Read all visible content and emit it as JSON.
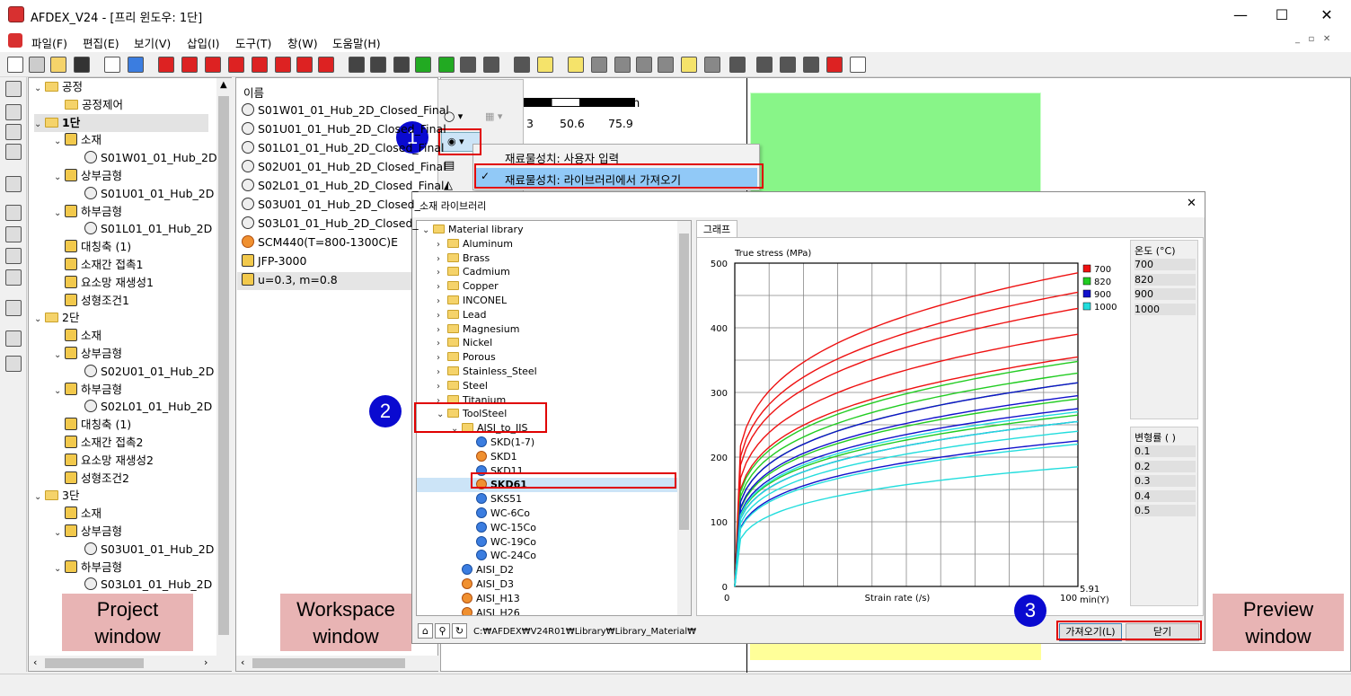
{
  "window": {
    "title": "AFDEX_V24 - [프리 윈도우: 1단]",
    "min": "—",
    "max": "☐",
    "close": "✕"
  },
  "menu": [
    "파일(F)",
    "편집(E)",
    "보기(V)",
    "삽입(I)",
    "도구(T)",
    "창(W)",
    "도움말(H)"
  ],
  "project_tree": [
    {
      "label": "공정",
      "icon": "folder-icon"
    },
    {
      "label": "공정제어",
      "icon": "folder-icon"
    },
    {
      "label": "1단",
      "icon": "folder-icon"
    },
    {
      "label": "소재",
      "icon": "material-icon"
    },
    {
      "label": "S01W01_01_Hub_2D",
      "icon": "mesh-icon"
    },
    {
      "label": "상부금형",
      "icon": "upper-die-icon"
    },
    {
      "label": "S01U01_01_Hub_2D",
      "icon": "mesh-icon"
    },
    {
      "label": "하부금형",
      "icon": "lower-die-icon"
    },
    {
      "label": "S01L01_01_Hub_2D",
      "icon": "mesh-icon"
    },
    {
      "label": "대칭축 (1)",
      "icon": "symmetry-icon"
    },
    {
      "label": "소재간 접촉1",
      "icon": "contact-icon"
    },
    {
      "label": "요소망 재생성1",
      "icon": "remesh-icon"
    },
    {
      "label": "성형조건1",
      "icon": "condition-icon"
    },
    {
      "label": "2단",
      "icon": "folder-icon"
    },
    {
      "label": "소재",
      "icon": "material-icon"
    },
    {
      "label": "상부금형",
      "icon": "upper-die-icon"
    },
    {
      "label": "S02U01_01_Hub_2D",
      "icon": "mesh-icon"
    },
    {
      "label": "하부금형",
      "icon": "lower-die-icon"
    },
    {
      "label": "S02L01_01_Hub_2D",
      "icon": "mesh-icon"
    },
    {
      "label": "대칭축 (1)",
      "icon": "symmetry-icon"
    },
    {
      "label": "소재간 접촉2",
      "icon": "contact-icon"
    },
    {
      "label": "요소망 재생성2",
      "icon": "remesh-icon"
    },
    {
      "label": "성형조건2",
      "icon": "condition-icon"
    },
    {
      "label": "3단",
      "icon": "folder-icon"
    },
    {
      "label": "소재",
      "icon": "material-icon"
    },
    {
      "label": "상부금형",
      "icon": "upper-die-icon"
    },
    {
      "label": "S03U01_01_Hub_2D",
      "icon": "mesh-icon"
    },
    {
      "label": "하부금형",
      "icon": "lower-die-icon"
    },
    {
      "label": "S03L01_01_Hub_2D",
      "icon": "mesh-icon"
    }
  ],
  "workspace": {
    "header": "이름",
    "items": [
      "S01W01_01_Hub_2D_Closed_Final",
      "S01U01_01_Hub_2D_Closed_Final",
      "S01L01_01_Hub_2D_Closed_Final",
      "S02U01_01_Hub_2D_Closed_Final",
      "S02L01_01_Hub_2D_Closed_Final",
      "S03U01_01_Hub_2D_Closed_",
      "S03L01_01_Hub_2D_Closed_",
      "SCM440(T=800-1300C)E",
      "JFP-3000",
      "u=0.3, m=0.8"
    ]
  },
  "scale": {
    "unit": "mm",
    "ticks": [
      "3",
      "50.6",
      "75.9"
    ]
  },
  "dropdown_menu": {
    "item1": "재료물성치: 사용자 입력",
    "item2": "재료물성치: 라이브러리에서 가져오기",
    "check": "✓"
  },
  "dialog": {
    "title": "소재 라이브러리",
    "close": "✕",
    "tab": "그래프",
    "path": "C:₩AFDEX₩V24R01₩Library₩Library_Material₩",
    "import_button": "가져오기(L)",
    "close_button": "닫기",
    "tree": [
      {
        "label": "Material library",
        "indent": 0,
        "type": "folder",
        "chev": "⌄"
      },
      {
        "label": "Aluminum",
        "indent": 1,
        "type": "folder",
        "chev": "›"
      },
      {
        "label": "Brass",
        "indent": 1,
        "type": "folder",
        "chev": "›"
      },
      {
        "label": "Cadmium",
        "indent": 1,
        "type": "folder",
        "chev": "›"
      },
      {
        "label": "Copper",
        "indent": 1,
        "type": "folder",
        "chev": "›"
      },
      {
        "label": "INCONEL",
        "indent": 1,
        "type": "folder",
        "chev": "›"
      },
      {
        "label": "Lead",
        "indent": 1,
        "type": "folder",
        "chev": "›"
      },
      {
        "label": "Magnesium",
        "indent": 1,
        "type": "folder",
        "chev": "›"
      },
      {
        "label": "Nickel",
        "indent": 1,
        "type": "folder",
        "chev": "›"
      },
      {
        "label": "Porous",
        "indent": 1,
        "type": "folder",
        "chev": "›"
      },
      {
        "label": "Stainless_Steel",
        "indent": 1,
        "type": "folder",
        "chev": "›"
      },
      {
        "label": "Steel",
        "indent": 1,
        "type": "folder",
        "chev": "›"
      },
      {
        "label": "Titanium",
        "indent": 1,
        "type": "folder",
        "chev": "›"
      },
      {
        "label": "ToolSteel",
        "indent": 1,
        "type": "folder",
        "chev": "⌄"
      },
      {
        "label": "AISI_to_JIS",
        "indent": 2,
        "type": "folder",
        "chev": "⌄"
      },
      {
        "label": "SKD(1-7)",
        "indent": 3,
        "type": "b",
        "chev": ""
      },
      {
        "label": "SKD1",
        "indent": 3,
        "type": "o",
        "chev": ""
      },
      {
        "label": "SKD11",
        "indent": 3,
        "type": "b",
        "chev": ""
      },
      {
        "label": "SKD61",
        "indent": 3,
        "type": "o",
        "chev": ""
      },
      {
        "label": "SKS51",
        "indent": 3,
        "type": "b",
        "chev": ""
      },
      {
        "label": "WC-6Co",
        "indent": 3,
        "type": "b",
        "chev": ""
      },
      {
        "label": "WC-15Co",
        "indent": 3,
        "type": "b",
        "chev": ""
      },
      {
        "label": "WC-19Co",
        "indent": 3,
        "type": "b",
        "chev": ""
      },
      {
        "label": "WC-24Co",
        "indent": 3,
        "type": "b",
        "chev": ""
      },
      {
        "label": "AISI_D2",
        "indent": 2,
        "type": "b",
        "chev": ""
      },
      {
        "label": "AISI_D3",
        "indent": 2,
        "type": "o",
        "chev": ""
      },
      {
        "label": "AISI_H13",
        "indent": 2,
        "type": "o",
        "chev": ""
      },
      {
        "label": "AISI_H26",
        "indent": 2,
        "type": "o",
        "chev": ""
      }
    ],
    "temp_header": "온도 (°C)",
    "temps": [
      "700",
      "820",
      "900",
      "1000"
    ],
    "strain_header": "변형률 ( )",
    "strains": [
      "0.1",
      "0.2",
      "0.3",
      "0.4",
      "0.5"
    ]
  },
  "chart_data": {
    "type": "line",
    "ylabel": "True stress (MPa)",
    "xlabel": "Strain rate (/s)",
    "x_tick_labels": [
      "0",
      "100"
    ],
    "y_tick_labels": [
      "0",
      "100",
      "200",
      "300",
      "400",
      "500"
    ],
    "ylim": [
      0,
      500
    ],
    "xlim": [
      0,
      100
    ],
    "x_extra_label": "5.91",
    "y_extra_label": "min(Y)",
    "legend_placement": "right",
    "grid": true,
    "series": [
      {
        "name": "700",
        "color": "#ee1111",
        "curves": [
          [
            80,
            355
          ],
          [
            95,
            390
          ],
          [
            115,
            430
          ],
          [
            130,
            455
          ],
          [
            150,
            485
          ]
        ]
      },
      {
        "name": "820",
        "color": "#22cc22",
        "curves": [
          [
            50,
            265
          ],
          [
            55,
            290
          ],
          [
            63,
            315
          ],
          [
            70,
            330
          ],
          [
            75,
            348
          ]
        ]
      },
      {
        "name": "900",
        "color": "#1111cc",
        "curves": [
          [
            35,
            225
          ],
          [
            45,
            255
          ],
          [
            52,
            275
          ],
          [
            57,
            295
          ],
          [
            62,
            315
          ]
        ]
      },
      {
        "name": "1000",
        "color": "#22dddd",
        "curves": [
          [
            25,
            185
          ],
          [
            35,
            220
          ],
          [
            40,
            240
          ],
          [
            44,
            255
          ],
          [
            48,
            270
          ]
        ]
      }
    ]
  },
  "annotations": {
    "n1": "1",
    "n2": "2",
    "n3": "3",
    "project": "Project window",
    "workspace": "Workspace window",
    "preview": "Preview window"
  }
}
